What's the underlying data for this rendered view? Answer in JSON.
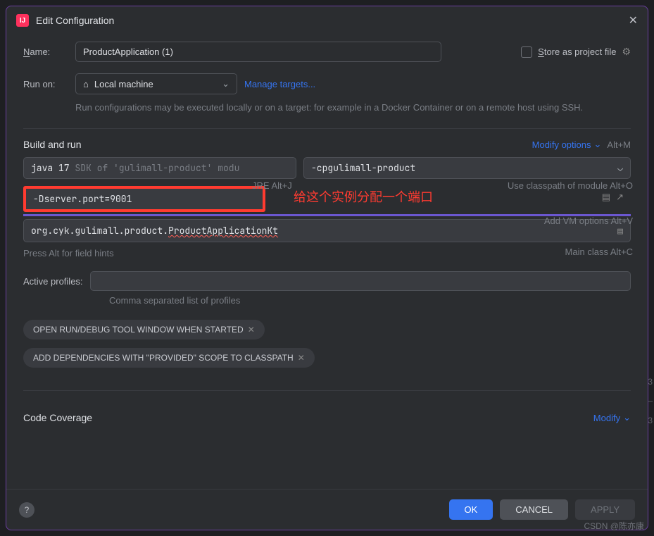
{
  "dialog": {
    "title": "Edit Configuration",
    "name_label": "Name:",
    "name_value": "ProductApplication (1)",
    "store_label": "Store as project file",
    "run_on_label": "Run on:",
    "run_on_value": "Local machine",
    "manage_targets": "Manage targets...",
    "run_hint": "Run configurations may be executed locally or on a target: for example in a Docker Container or on a remote host using SSH."
  },
  "build": {
    "section_title": "Build and run",
    "modify_options": "Modify options",
    "modify_shortcut": "Alt+M",
    "jre_hint": "JRE Alt+J",
    "classpath_hint": "Use classpath of module Alt+O",
    "vm_hint": "Add VM options Alt+V",
    "mainclass_hint": "Main class Alt+C",
    "jdk_prefix": "java 17 ",
    "jdk_rest": "SDK of 'gulimall-product' modu",
    "cp_flag": "-cp ",
    "cp_value": "gulimall-product",
    "vm_value": "-Dserver.port=9001",
    "vm_annotation": "给这个实例分配一个端口",
    "mainclass_prefix": "org.cyk.gulimall.product.",
    "mainclass_err": "ProductApplicationKt",
    "field_hint": "Press Alt for field hints"
  },
  "profiles": {
    "label": "Active profiles:",
    "hint": "Comma separated list of profiles"
  },
  "chips": {
    "chip1": "OPEN RUN/DEBUG TOOL WINDOW WHEN STARTED",
    "chip2": "ADD DEPENDENCIES WITH \"PROVIDED\" SCOPE TO CLASSPATH"
  },
  "coverage": {
    "title": "Code Coverage",
    "modify": "Modify"
  },
  "footer": {
    "ok": "OK",
    "cancel": "CANCEL",
    "apply": "APPLY"
  },
  "watermark": "CSDN @陈亦康",
  "side_marks": {
    "a": "3",
    "b": "–",
    "c": "3"
  }
}
